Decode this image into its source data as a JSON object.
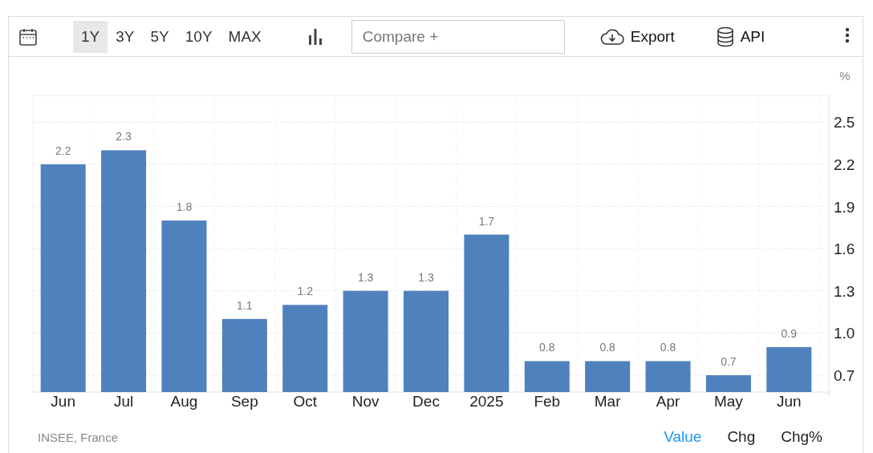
{
  "toolbar": {
    "ranges": [
      {
        "label": "1Y",
        "selected": true
      },
      {
        "label": "3Y",
        "selected": false
      },
      {
        "label": "5Y",
        "selected": false
      },
      {
        "label": "10Y",
        "selected": false
      },
      {
        "label": "MAX",
        "selected": false
      }
    ],
    "compare": {
      "placeholder": "Compare +"
    },
    "export": "Export",
    "api": "API"
  },
  "chart": {
    "unit": "%",
    "chart_data": {
      "type": "bar",
      "categories": [
        "Jun",
        "Jul",
        "Aug",
        "Sep",
        "Oct",
        "Nov",
        "Dec",
        "2025",
        "Feb",
        "Mar",
        "Apr",
        "May",
        "Jun"
      ],
      "series": [
        {
          "color": "#4f81bd",
          "values": [
            2.2,
            2.3,
            1.8,
            1.1,
            1.2,
            1.3,
            1.3,
            1.7,
            0.8,
            0.8,
            0.8,
            0.7,
            0.9
          ]
        }
      ],
      "ylim": [
        0.58,
        2.69
      ],
      "yticks": [
        {
          "value": 0.7,
          "label": "0.7"
        },
        {
          "value": 1.0,
          "label": "1.0"
        },
        {
          "value": 1.3,
          "label": "1.3"
        },
        {
          "value": 1.6,
          "label": "1.6"
        },
        {
          "value": 1.9,
          "label": "1.9"
        },
        {
          "value": 2.2,
          "label": "2.2"
        },
        {
          "value": 2.5,
          "label": "2.5"
        }
      ],
      "data_labels": true,
      "grid": true
    }
  },
  "footer": {
    "source": "INSEE, France",
    "views": [
      {
        "label": "Value",
        "selected": true
      },
      {
        "label": "Chg",
        "selected": false
      },
      {
        "label": "Chg%",
        "selected": false
      }
    ]
  }
}
